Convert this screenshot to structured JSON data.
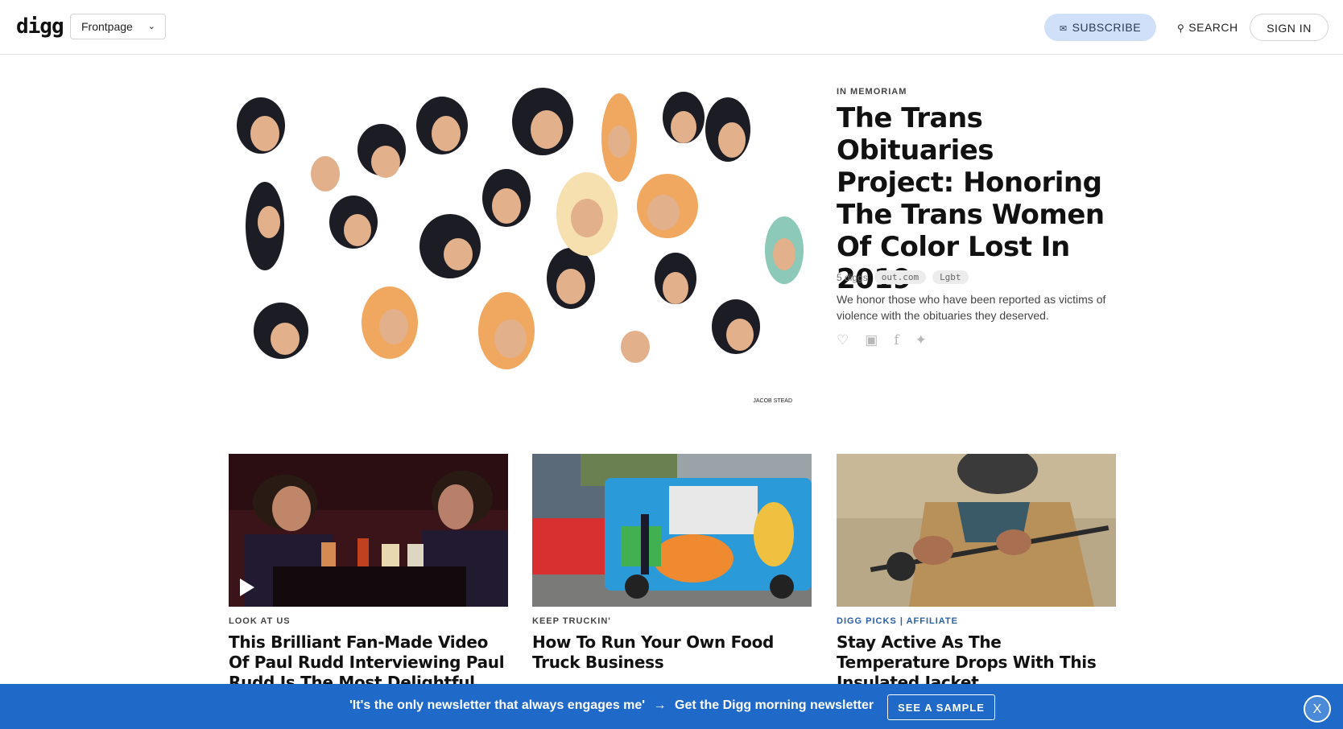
{
  "header": {
    "logo": "digg",
    "dropdown_label": "Frontpage",
    "subscribe_label": "SUBSCRIBE",
    "search_label": "SEARCH",
    "signin_label": "SIGN IN"
  },
  "hero": {
    "kicker": "IN MEMORIAM",
    "title": "The Trans Obituaries Project: Honoring The Trans Women Of Color Lost In 2019",
    "diggs": "5 diggs",
    "tags": [
      "out.com",
      "Lgbt"
    ],
    "description": "We honor those who have been reported as victims of violence with the obituaries they deserved.",
    "image_credit": "JACOB STEAD"
  },
  "cards": [
    {
      "kicker": "LOOK AT US",
      "title": "This Brilliant Fan-Made Video Of Paul Rudd Interviewing Paul Rudd Is The Most Delightful Thing"
    },
    {
      "kicker": "KEEP TRUCKIN'",
      "title": "How To Run Your Own Food Truck Business"
    },
    {
      "kicker": "DIGG PICKS | AFFILIATE",
      "title": "Stay Active As The Temperature Drops With This Insulated Jacket"
    }
  ],
  "newsletter": {
    "quote": "'It's the only newsletter that always engages me'",
    "arrow": "→",
    "cta_text": "Get the Digg morning newsletter",
    "button_label": "SEE A SAMPLE",
    "close_label": "X"
  },
  "colors": {
    "accent_blue": "#1f69c9",
    "subscribe_bg": "#cfe0f8",
    "affiliate_kicker": "#2a5fa8"
  }
}
